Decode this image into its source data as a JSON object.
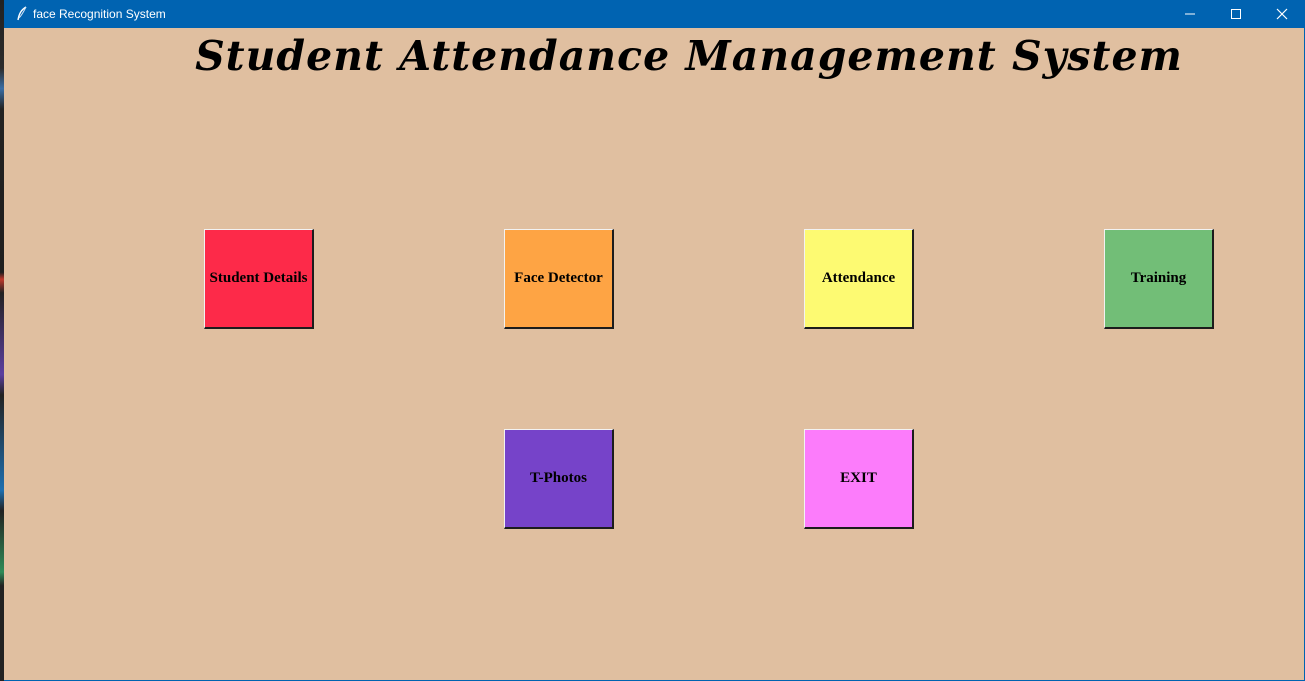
{
  "window": {
    "title": "face Recognition System",
    "title_icon": "feather-icon",
    "controls": [
      "minimize-icon",
      "maximize-icon",
      "close-icon"
    ],
    "titlebar_color": "#0063b1",
    "background_color": "#e0bfa0"
  },
  "heading": "Student Attendance Management System",
  "buttons": {
    "student_details": {
      "label": "Student Details",
      "color": "#fd2a49"
    },
    "face_detector": {
      "label": "Face Detector",
      "color": "#fea444"
    },
    "attendance": {
      "label": "Attendance",
      "color": "#fdfa72"
    },
    "training": {
      "label": "Training",
      "color": "#72be77"
    },
    "t_photos": {
      "label": "T-Photos",
      "color": "#7643c9"
    },
    "exit": {
      "label": "EXIT",
      "color": "#fc7cfb"
    }
  }
}
